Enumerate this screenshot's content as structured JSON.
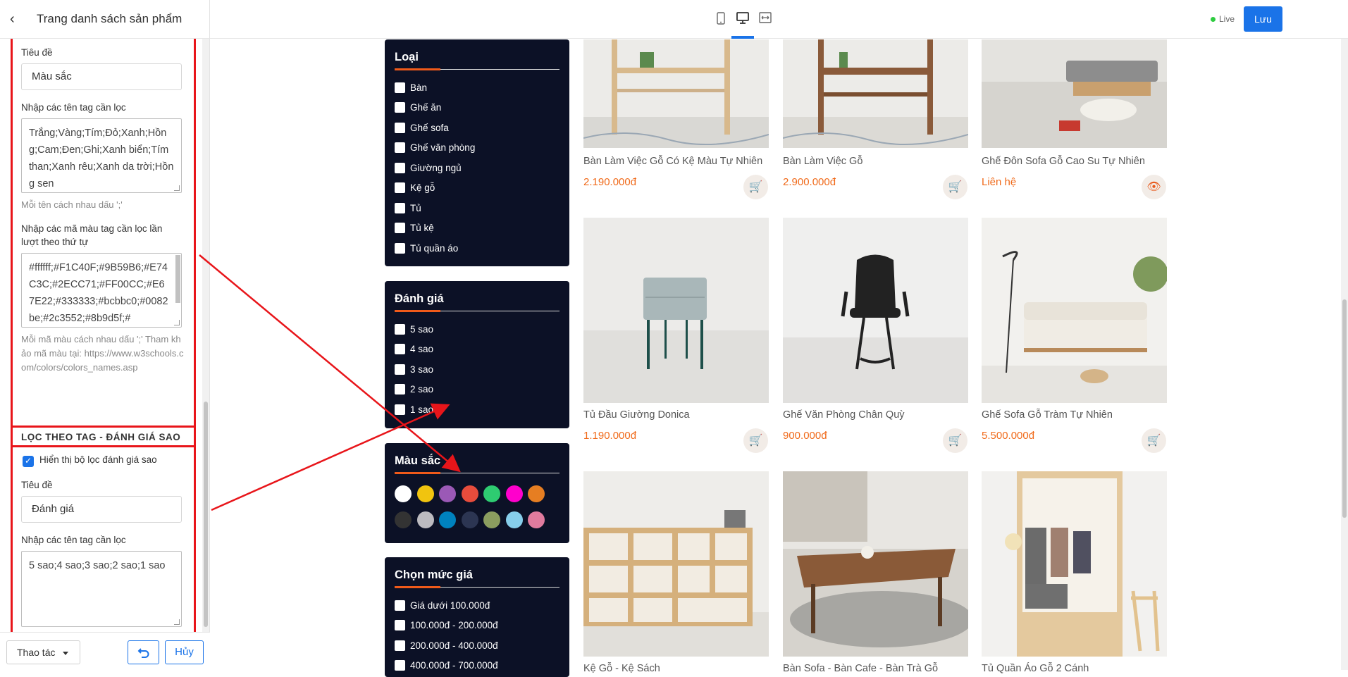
{
  "sidebar": {
    "title": "Trang danh sách sản phẩm",
    "color_filter": {
      "title_label": "Tiêu đề",
      "title_value": "Màu sắc",
      "tags_label": "Nhập các tên tag cần lọc",
      "tags_value": "Trắng;Vàng;Tím;Đỏ;Xanh;Hồng;Cam;Đen;Ghi;Xanh biển;Tím than;Xanh rêu;Xanh da trời;Hồng sen",
      "tags_hint": "Mỗi tên cách nhau dấu ';'",
      "codes_label": "Nhập các mã màu tag cần lọc lần lượt theo thứ tự",
      "codes_value": "#ffffff;#F1C40F;#9B59B6;#E74C3C;#2ECC71;#FF00CC;#E67E22;#333333;#bcbbc0;#0082be;#2c3552;#8b9d5f;#",
      "codes_hint": "Mỗi mã màu cách nhau dấu ';' Tham khảo mã màu tại: https://www.w3schools.com/colors/colors_names.asp"
    },
    "rating_filter": {
      "group_title": "LỌC THEO TAG - ĐÁNH GIÁ SAO",
      "show_label": "Hiển thị bộ lọc đánh giá sao",
      "title_label": "Tiêu đề",
      "title_value": "Đánh giá",
      "tags_label": "Nhập các tên tag cần lọc",
      "tags_value": "5 sao;4 sao;3 sao;2 sao;1 sao"
    },
    "footer": {
      "action_label": "Thao tác",
      "cancel_label": "Hủy"
    }
  },
  "topbar": {
    "live_label": "Live",
    "save_label": "Lưu"
  },
  "filters": {
    "type": {
      "title": "Loại",
      "items": [
        "Bàn",
        "Ghế ăn",
        "Ghế sofa",
        "Ghế văn phòng",
        "Giường ngủ",
        "Kệ gỗ",
        "Tủ",
        "Tủ kệ",
        "Tủ quần áo"
      ]
    },
    "rating": {
      "title": "Đánh giá",
      "items": [
        "5 sao",
        "4 sao",
        "3 sao",
        "2 sao",
        "1 sao"
      ]
    },
    "color": {
      "title": "Màu sắc",
      "swatches": [
        "#ffffff",
        "#F1C40F",
        "#9B59B6",
        "#E74C3C",
        "#2ECC71",
        "#FF00CC",
        "#E67E22",
        "#333333",
        "#bcbbc0",
        "#0082be",
        "#2c3552",
        "#8b9d5f",
        "#87ceeb",
        "#e07b9e"
      ]
    },
    "price": {
      "title": "Chọn mức giá",
      "items": [
        "Giá dưới 100.000đ",
        "100.000đ - 200.000đ",
        "200.000đ - 400.000đ",
        "400.000đ - 700.000đ"
      ]
    }
  },
  "products": [
    {
      "name": "Bàn Làm Việc Gỗ Có Kệ Màu Tự Nhiên",
      "price": "2.190.000đ",
      "action_icon": "basket-icon"
    },
    {
      "name": "Bàn Làm Việc Gỗ",
      "price": "2.900.000đ",
      "action_icon": "basket-icon"
    },
    {
      "name": "Ghế Đôn Sofa Gỗ Cao Su Tự Nhiên",
      "price": "Liên hệ",
      "action_icon": "eye-icon"
    },
    {
      "name": "Tủ Đầu Giường Donica",
      "price": "1.190.000đ",
      "action_icon": "basket-icon"
    },
    {
      "name": "Ghế Văn Phòng Chân Quỳ",
      "price": "900.000đ",
      "action_icon": "basket-icon"
    },
    {
      "name": "Ghế Sofa Gỗ Tràm Tự Nhiên",
      "price": "5.500.000đ",
      "action_icon": "basket-icon"
    },
    {
      "name": "Kệ Gỗ - Kệ Sách",
      "price": "",
      "action_icon": ""
    },
    {
      "name": "Bàn Sofa - Bàn Cafe - Bàn Trà Gỗ",
      "price": "",
      "action_icon": ""
    },
    {
      "name": "Tủ Quần Áo Gỗ 2 Cánh",
      "price": "",
      "action_icon": ""
    }
  ]
}
